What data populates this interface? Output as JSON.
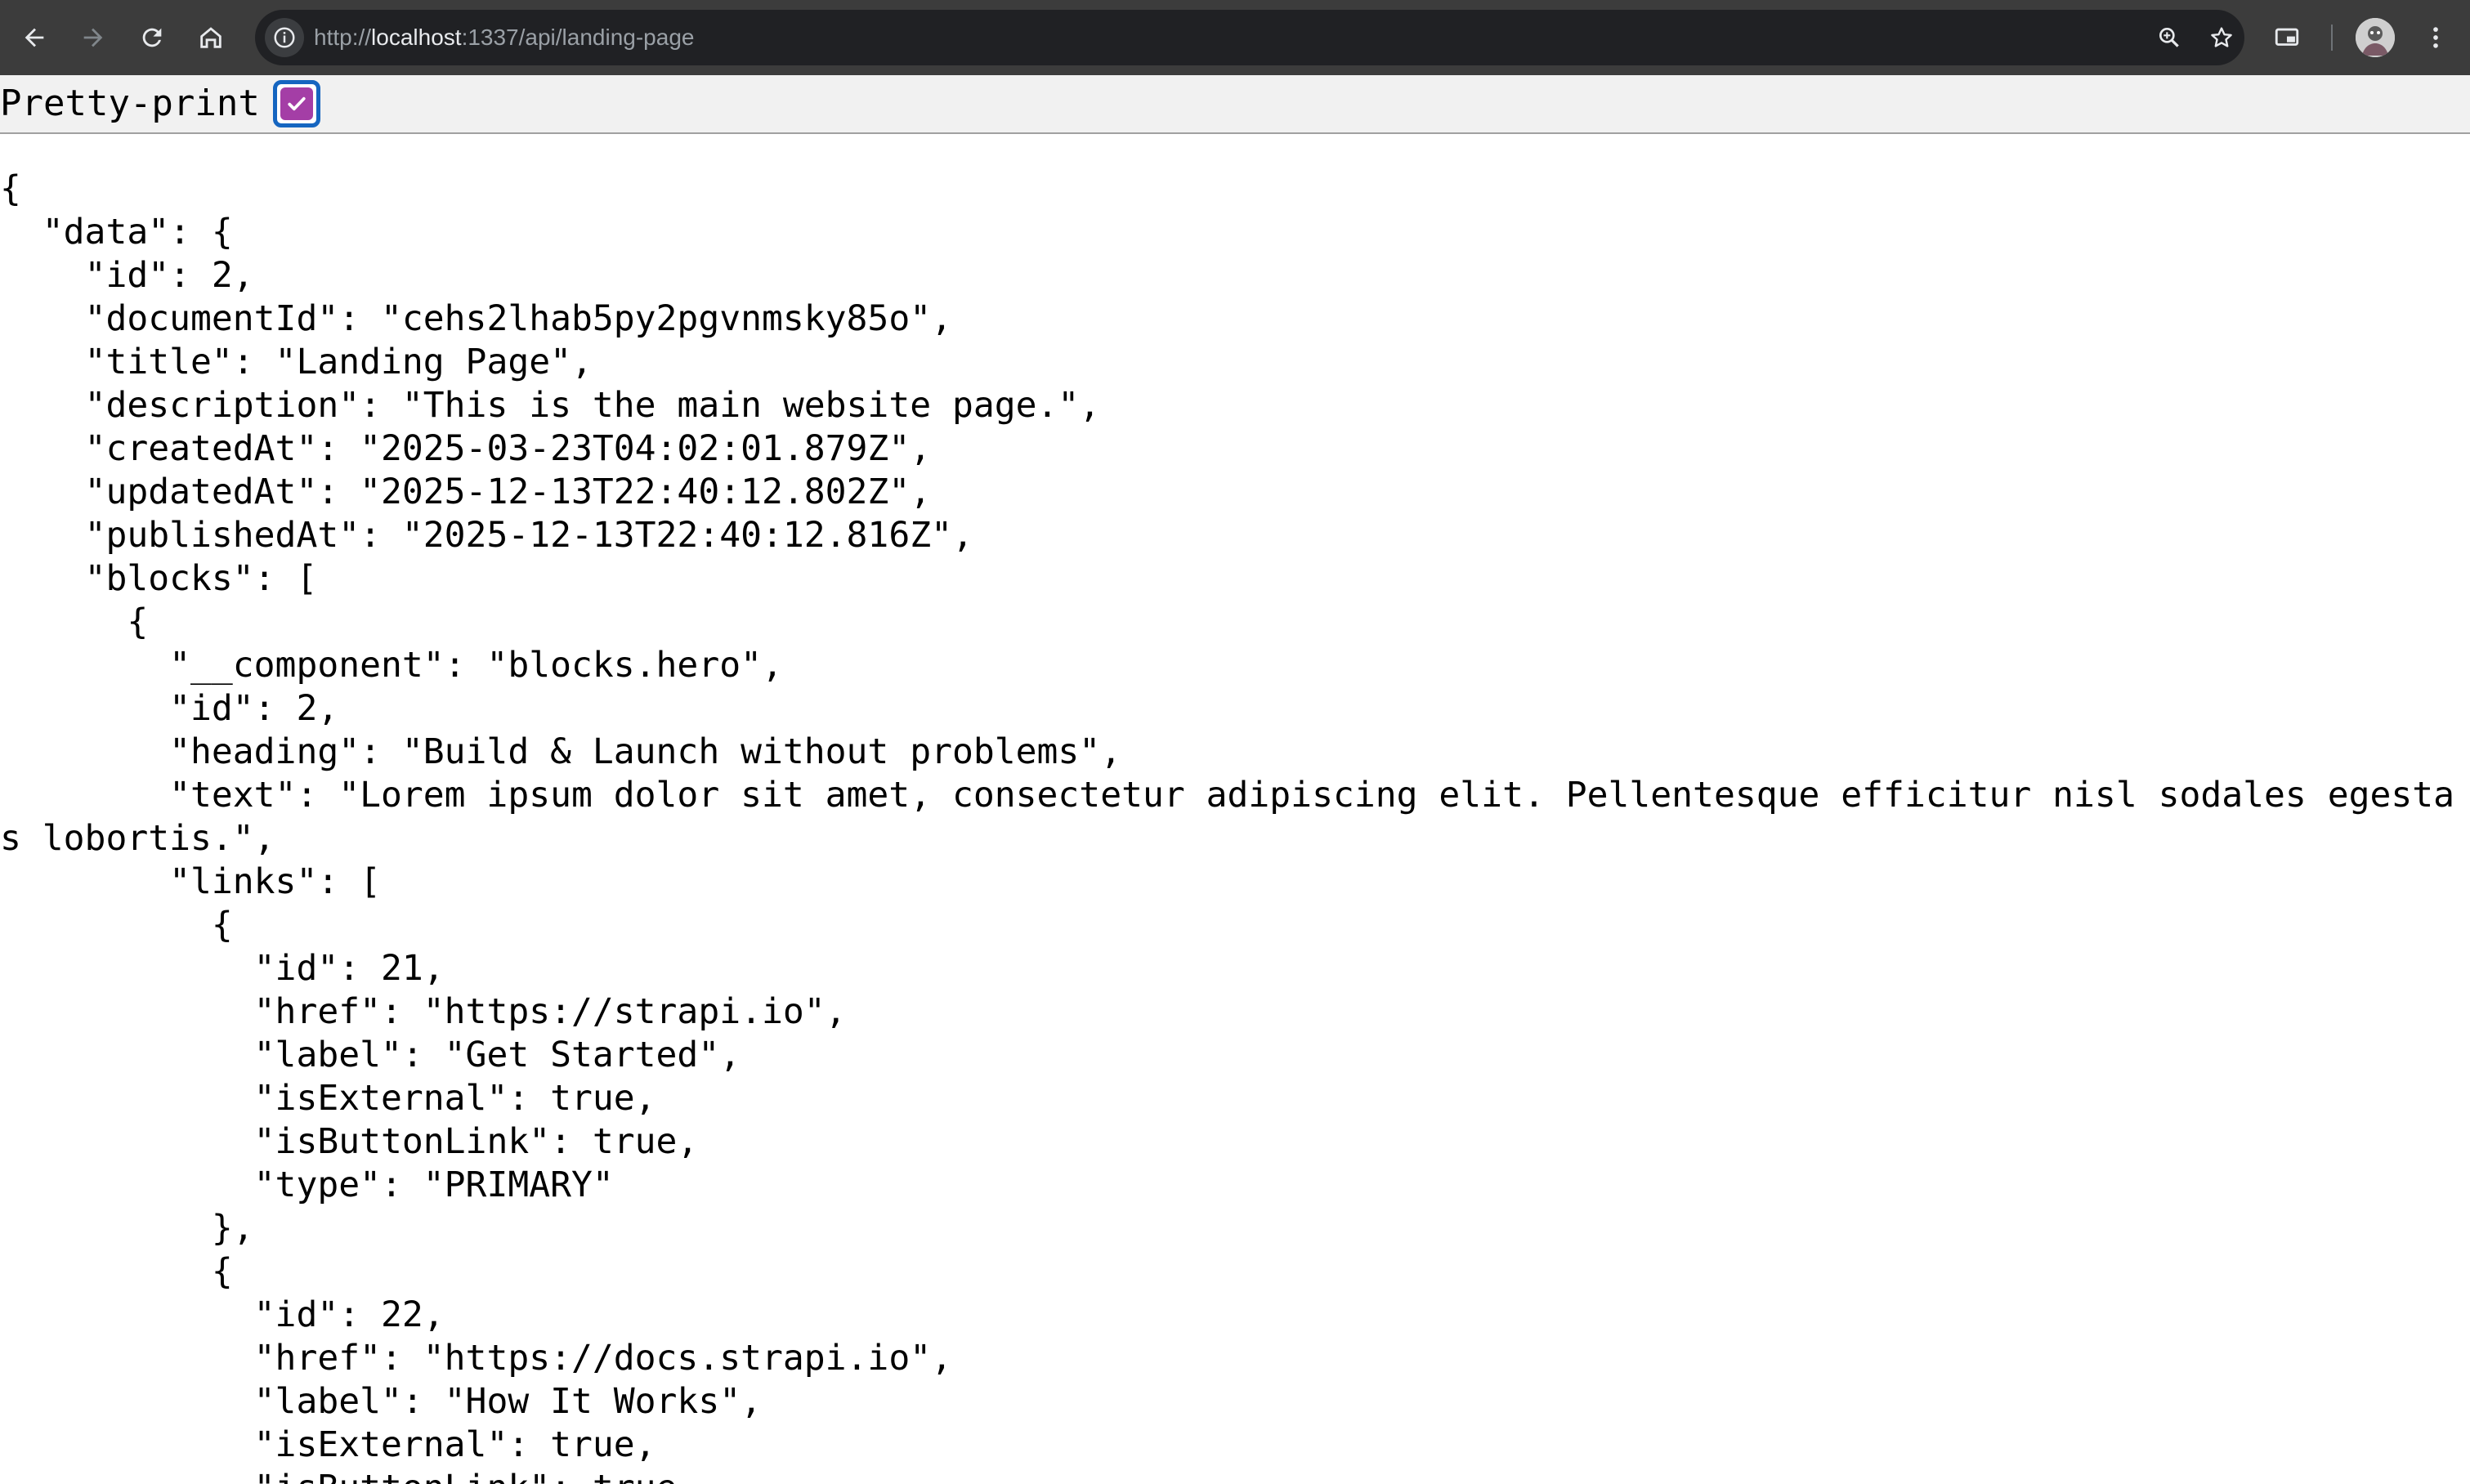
{
  "browser": {
    "url": {
      "scheme": "http://",
      "host": "localhost",
      "path": ":1337/api/landing-page"
    },
    "icons": {
      "back": "arrow-left-icon",
      "forward": "arrow-right-icon",
      "reload": "reload-icon",
      "home": "home-icon",
      "site_info": "info-icon",
      "zoom": "zoom-icon",
      "bookmark": "star-icon",
      "cast": "cast-icon",
      "menu": "kebab-menu-icon"
    },
    "colors": {
      "toolbar": "#3c3c3c",
      "omnibox": "#202124"
    }
  },
  "pretty_print": {
    "label": "Pretty-print",
    "checked": true,
    "accent": "#a43ea6",
    "focus_ring": "#1565c0"
  },
  "json_text": "{\n  \"data\": {\n    \"id\": 2,\n    \"documentId\": \"cehs2lhab5py2pgvnmsky85o\",\n    \"title\": \"Landing Page\",\n    \"description\": \"This is the main website page.\",\n    \"createdAt\": \"2025-03-23T04:02:01.879Z\",\n    \"updatedAt\": \"2025-12-13T22:40:12.802Z\",\n    \"publishedAt\": \"2025-12-13T22:40:12.816Z\",\n    \"blocks\": [\n      {\n        \"__component\": \"blocks.hero\",\n        \"id\": 2,\n        \"heading\": \"Build & Launch without problems\",\n        \"text\": \"Lorem ipsum dolor sit amet, consectetur adipiscing elit. Pellentesque efficitur nisl sodales egestas lobortis.\",\n        \"links\": [\n          {\n            \"id\": 21,\n            \"href\": \"https://strapi.io\",\n            \"label\": \"Get Started\",\n            \"isExternal\": true,\n            \"isButtonLink\": true,\n            \"type\": \"PRIMARY\"\n          },\n          {\n            \"id\": 22,\n            \"href\": \"https://docs.strapi.io\",\n            \"label\": \"How It Works\",\n            \"isExternal\": true,\n            \"isButtonLink\": true,"
}
